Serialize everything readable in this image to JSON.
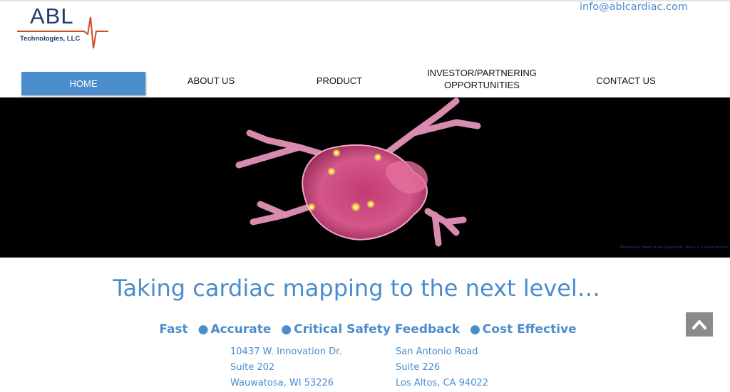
{
  "brand": {
    "name": "ABL",
    "subtitle": "Technologies, LLC",
    "line_color": "#d24a1e",
    "text_color": "#1f3b70"
  },
  "header": {
    "email": "info@ablcardiac.com"
  },
  "nav": {
    "items": [
      {
        "label": "HOME",
        "active": true
      },
      {
        "label": "ABOUT US",
        "active": false
      },
      {
        "label": "PRODUCT",
        "active": false
      },
      {
        "label": "INVESTOR/PARTNERING\nOPPORTUNITIES",
        "active": false
      },
      {
        "label": "CONTACT US",
        "active": false
      }
    ],
    "active_color": "#4a8ccc"
  },
  "hero": {
    "caption": "Powered by Heart of the Diagnostic: Music is a Video Feature",
    "background": "#000000"
  },
  "main": {
    "tagline": "Taking cardiac mapping to the next level…",
    "features": [
      "Fast",
      "Accurate",
      "Critical Safety Feedback",
      "Cost Effective"
    ],
    "bullet": "●",
    "accent_color": "#4a8ccc"
  },
  "addresses": [
    {
      "line1": "10437 W. Innovation Dr.",
      "line2": "Suite 202",
      "line3": "Wauwatosa, WI 53226"
    },
    {
      "line1": "San Antonio Road",
      "line2": "Suite 226",
      "line3": "Los Altos, CA 94022"
    }
  ],
  "scroll_top": {
    "icon": "chevron-up-icon"
  }
}
